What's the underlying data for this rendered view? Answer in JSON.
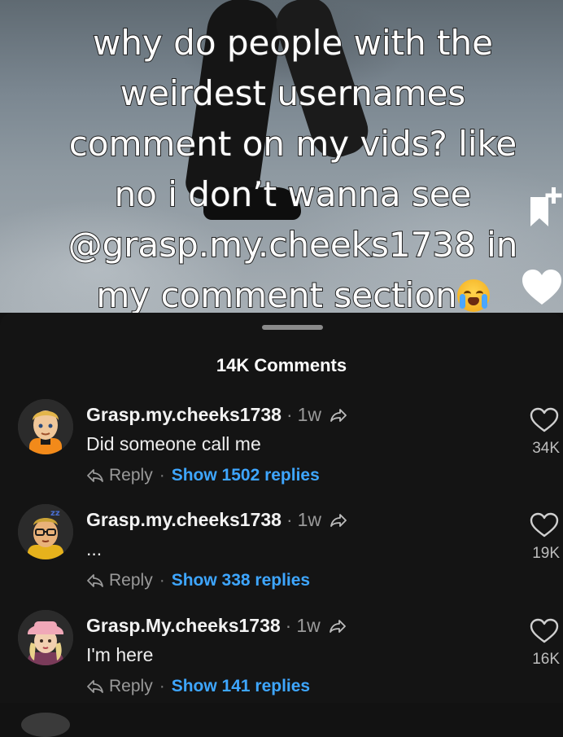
{
  "video": {
    "caption": "why do people with the\nweirdest usernames\ncomment on my vids? like\nno i don’t wanna see\n@grasp.my.cheeks1738 in\nmy comment section",
    "caption_emoji": "loudly-crying-face"
  },
  "comments_sheet": {
    "title": "14K Comments",
    "comments": [
      {
        "username": "Grasp.my.cheeks1738",
        "time": "1w",
        "text": "Did someone call me",
        "reply_label": "Reply",
        "show_replies": "Show 1502 replies",
        "likes": "34K"
      },
      {
        "username": "Grasp.my.cheeks1738",
        "time": "1w",
        "text": "...",
        "reply_label": "Reply",
        "show_replies": "Show 338 replies",
        "likes": "19K"
      },
      {
        "username": "Grasp.My.cheeks1738",
        "time": "1w",
        "text": "I'm here",
        "reply_label": "Reply",
        "show_replies": "Show 141 replies",
        "likes": "16K"
      }
    ]
  },
  "separator": "·",
  "colors": {
    "sheet_bg": "#141414",
    "link_blue": "#3ea6ff",
    "muted_gray": "#9a9a9a"
  }
}
